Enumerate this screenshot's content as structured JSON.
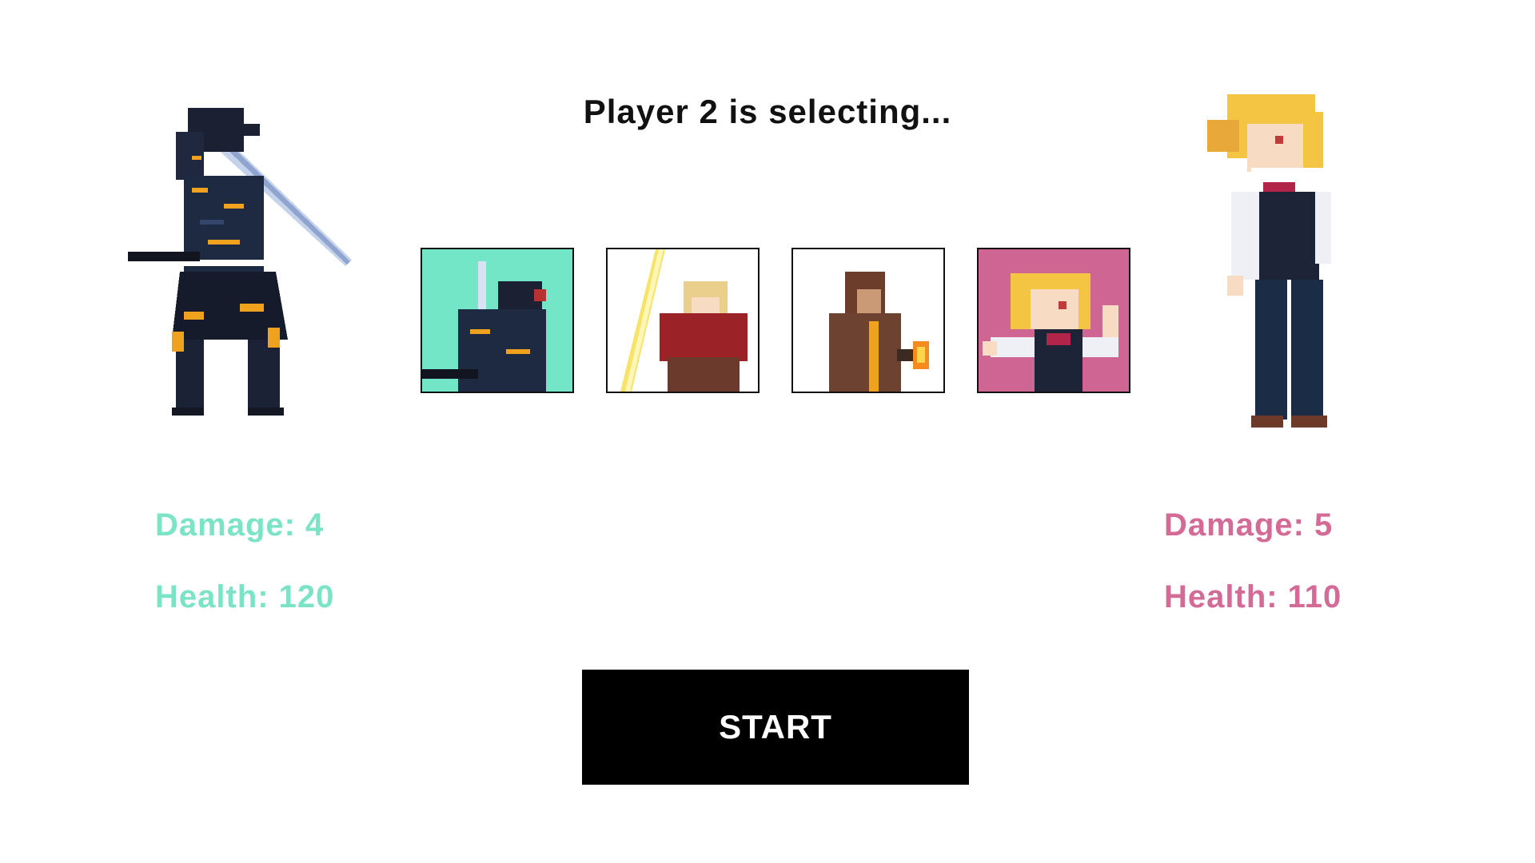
{
  "screen": {
    "status_text": "Player 2 is selecting..."
  },
  "player1": {
    "character_icon": "armored-samurai",
    "damage_text": "Damage: 4",
    "health_text": "Health: 120",
    "color": "#7be3c6"
  },
  "player2": {
    "character_icon": "blonde-girl-fighter",
    "damage_text": "Damage: 5",
    "health_text": "Health: 110",
    "color": "#d46a96"
  },
  "roster": [
    {
      "icon": "samurai-portrait",
      "background": "#72e6c6"
    },
    {
      "icon": "swordsman-portrait",
      "background": "#ffffff"
    },
    {
      "icon": "monk-portrait",
      "background": "#ffffff"
    },
    {
      "icon": "blonde-girl-portrait",
      "background": "#cf6593"
    }
  ],
  "start_button": {
    "label": "START"
  }
}
